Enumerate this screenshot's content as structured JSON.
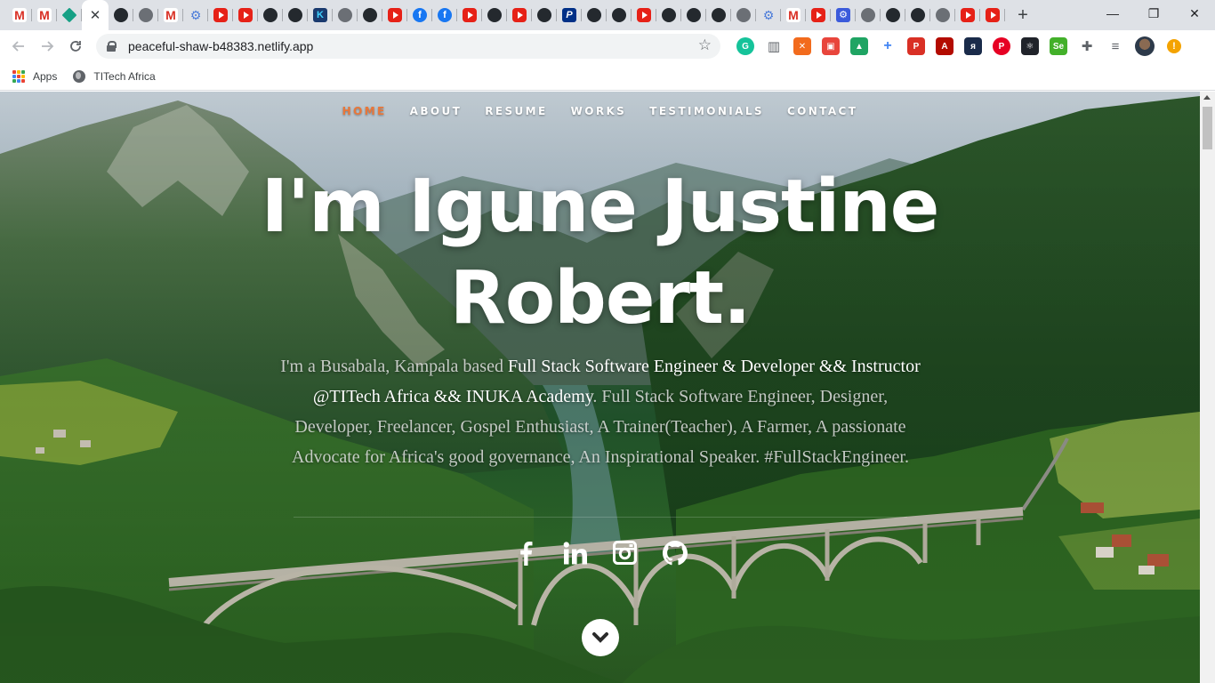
{
  "browser": {
    "tabs": [
      {
        "icon": "gmail-icon",
        "glyph": "M"
      },
      {
        "icon": "gmail-icon",
        "glyph": "M"
      },
      {
        "icon": "diamond-icon",
        "glyph": ""
      },
      {
        "icon": "close-icon",
        "glyph": "✕",
        "active": true
      },
      {
        "icon": "github-icon",
        "glyph": ""
      },
      {
        "icon": "globe-icon",
        "glyph": ""
      },
      {
        "icon": "gmail-icon",
        "glyph": "M"
      },
      {
        "icon": "gear-icon",
        "glyph": "⚙"
      },
      {
        "icon": "youtube-icon",
        "glyph": ""
      },
      {
        "icon": "youtube-icon",
        "glyph": ""
      },
      {
        "icon": "github-icon",
        "glyph": ""
      },
      {
        "icon": "github-icon",
        "glyph": ""
      },
      {
        "icon": "kotlin-icon",
        "glyph": "K"
      },
      {
        "icon": "globe-icon",
        "glyph": ""
      },
      {
        "icon": "github-icon",
        "glyph": ""
      },
      {
        "icon": "youtube-icon",
        "glyph": ""
      },
      {
        "icon": "facebook-icon",
        "glyph": "f"
      },
      {
        "icon": "facebook-icon",
        "glyph": "f"
      },
      {
        "icon": "youtube-icon",
        "glyph": ""
      },
      {
        "icon": "github-icon",
        "glyph": ""
      },
      {
        "icon": "youtube-icon",
        "glyph": ""
      },
      {
        "icon": "github-icon",
        "glyph": ""
      },
      {
        "icon": "paypal-icon",
        "glyph": "P"
      },
      {
        "icon": "github-icon",
        "glyph": ""
      },
      {
        "icon": "github-icon",
        "glyph": ""
      },
      {
        "icon": "youtube-icon",
        "glyph": ""
      },
      {
        "icon": "github-icon",
        "glyph": ""
      },
      {
        "icon": "github-icon",
        "glyph": ""
      },
      {
        "icon": "github-icon",
        "glyph": ""
      },
      {
        "icon": "globe-icon",
        "glyph": ""
      },
      {
        "icon": "gear-icon",
        "glyph": "⚙"
      },
      {
        "icon": "gmail-icon",
        "glyph": "M"
      },
      {
        "icon": "youtube-icon",
        "glyph": ""
      },
      {
        "icon": "gear-box-icon",
        "glyph": "⚙"
      },
      {
        "icon": "globe-icon",
        "glyph": ""
      },
      {
        "icon": "github-icon",
        "glyph": ""
      },
      {
        "icon": "github-icon",
        "glyph": ""
      },
      {
        "icon": "globe-icon",
        "glyph": ""
      },
      {
        "icon": "youtube-icon",
        "glyph": ""
      },
      {
        "icon": "youtube-icon",
        "glyph": ""
      }
    ],
    "new_tab_glyph": "+",
    "window_controls": {
      "minimize": "—",
      "restore": "❐",
      "close": "✕"
    },
    "url": "peaceful-shaw-b48383.netlify.app",
    "star_glyph": "☆",
    "extensions": [
      {
        "icon": "grammarly-icon",
        "color": "#15c39a",
        "glyph": "G"
      },
      {
        "icon": "reader-icon",
        "color": "#5f6368",
        "glyph": "▥"
      },
      {
        "icon": "extension-orange-icon",
        "color": "#f26b1d",
        "glyph": "✕"
      },
      {
        "icon": "extension-cube-icon",
        "color": "#e8453c",
        "glyph": "▣"
      },
      {
        "icon": "google-drive-icon",
        "color": "#1fa463",
        "glyph": "▲"
      },
      {
        "icon": "google-plus-icon",
        "color": "#ffffff",
        "glyph": "+"
      },
      {
        "icon": "pdf-icon",
        "color": "#d93025",
        "glyph": "P"
      },
      {
        "icon": "acrobat-icon",
        "color": "#b30b00",
        "glyph": "A"
      },
      {
        "icon": "extension-dark-icon",
        "color": "#1a2b4a",
        "glyph": "ᴙ"
      },
      {
        "icon": "pinterest-icon",
        "color": "#e60023",
        "glyph": "P"
      },
      {
        "icon": "react-icon",
        "color": "#20232a",
        "glyph": "⚛"
      },
      {
        "icon": "selenium-icon",
        "color": "#43b02a",
        "glyph": "Se"
      },
      {
        "icon": "puzzle-icon",
        "color": "#5f6368",
        "glyph": "✚"
      },
      {
        "icon": "media-queue-icon",
        "color": "#5f6368",
        "glyph": "≡"
      }
    ],
    "alert_glyph": "!",
    "bookmarks": [
      {
        "label": "Apps",
        "icon": "apps-grid-icon"
      },
      {
        "label": "TITech Africa",
        "icon": "globe-icon"
      }
    ]
  },
  "site": {
    "nav": [
      {
        "label": "HOME",
        "current": true
      },
      {
        "label": "ABOUT"
      },
      {
        "label": "RESUME"
      },
      {
        "label": "WORKS"
      },
      {
        "label": "TESTIMONIALS"
      },
      {
        "label": "CONTACT"
      }
    ],
    "headline_line1": "I'm Igune Justine",
    "headline_line2": "Robert.",
    "intro": {
      "pre": "I'm a Busabala, Kampala based ",
      "strong": "Full Stack Software Engineer & Developer && Instructor @TITech Africa && INUKA Academy",
      "post": ". Full Stack Software Engineer, Designer, Developer, Freelancer, Gospel Enthusiast, A Trainer(Teacher), A Farmer, A passionate Advocate for Africa's good governance, An Inspirational Speaker. #FullStackEngineer."
    },
    "socials": [
      "facebook-icon",
      "linkedin-icon",
      "instagram-icon",
      "github-icon"
    ],
    "accent": "#e8773a"
  }
}
